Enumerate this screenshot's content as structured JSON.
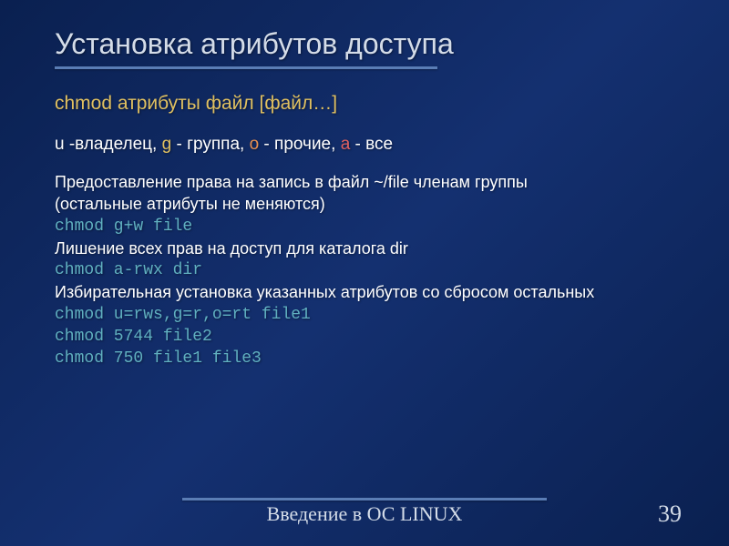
{
  "title": "Установка атрибутов доступа",
  "cmd_syntax": "chmod атрибуты файл [файл…]",
  "categories": {
    "u_key": "u",
    "u_label": " -владелец, ",
    "g_key": "g",
    "g_label": " - группа, ",
    "o_key": "o",
    "o_label": " - прочие, ",
    "a_key": "a",
    "a_label": " - все"
  },
  "lines": {
    "l1": "Предоставление права на запись в файл ~/file членам группы",
    "l2": "(остальные атрибуты не меняются)",
    "l3": "chmod g+w file",
    "l4": "Лишение всех прав на доступ для каталога dir",
    "l5": "chmod a-rwx dir",
    "l6": "Избирательная установка указанных атрибутов со сбросом остальных",
    "l7": "chmod u=rws,g=r,o=rt file1",
    "l8": "chmod 5744 file2",
    "l9": "chmod 750 file1 file3"
  },
  "footer": "Введение в ОС LINUX",
  "page": "39"
}
